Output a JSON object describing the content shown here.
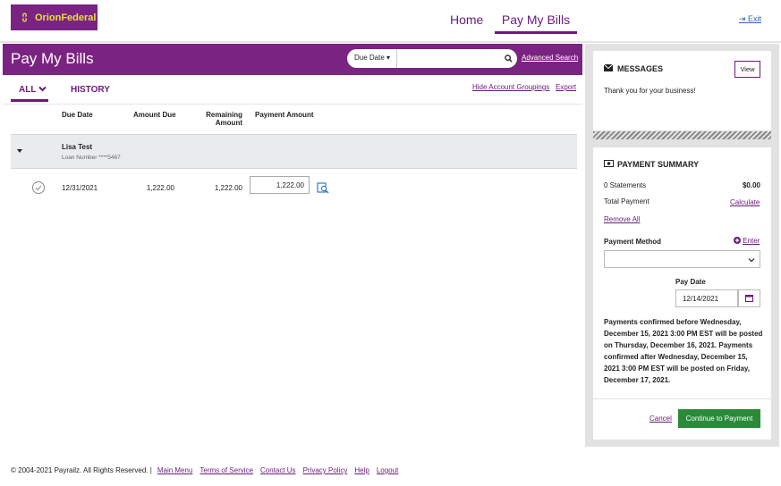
{
  "brand": {
    "name": "OrionFederal",
    "color": "#7b2382",
    "accent": "#e4e13a"
  },
  "nav": {
    "home": "Home",
    "pay_my_bills": "Pay My Bills",
    "exit": "Exit"
  },
  "page": {
    "title": "Pay My Bills",
    "search": {
      "filter": "Due Date",
      "placeholder": "",
      "advanced": "Advanced Search"
    },
    "tabs": {
      "all": "ALL",
      "history": "HISTORY"
    },
    "links": {
      "hide_groupings": "Hide Account Groupings",
      "export": "Export"
    }
  },
  "table": {
    "headers": {
      "due_date": "Due Date",
      "amount_due": "Amount Due",
      "remaining_1": "Remaining",
      "remaining_2": "Amount",
      "payment_amount": "Payment Amount"
    },
    "group": {
      "name": "Lisa Test",
      "loan": "Loan Number ****5467"
    },
    "rows": [
      {
        "due_date": "12/31/2021",
        "amount_due": "1,222.00",
        "remaining": "1,222.00",
        "payment": "1,222.00"
      }
    ]
  },
  "messages": {
    "title": "MESSAGES",
    "view": "View",
    "body": "Thank you for your business!"
  },
  "summary": {
    "title": "PAYMENT SUMMARY",
    "statements_label": "0 Statements",
    "statements_value": "$0.00",
    "total_label": "Total Payment",
    "calculate": "Calculate",
    "remove_all": "Remove All",
    "method_label": "Payment Method",
    "enter": "Enter",
    "pay_date_label": "Pay Date",
    "pay_date": "12/14/2021",
    "notice": "Payments confirmed before Wednesday, December 15, 2021 3:00 PM EST will be posted on Thursday, December 16, 2021. Payments confirmed after Wednesday, December 15, 2021 3:00 PM EST will be posted on Friday, December 17, 2021.",
    "cancel": "Cancel",
    "continue": "Continue to Payment"
  },
  "footer": {
    "copyright": "© 2004-2021 Payrailz. All Rights Reserved. |",
    "links": [
      "Main Menu",
      "Terms of Service",
      "Contact Us",
      "Privacy Policy",
      "Help",
      "Logout"
    ]
  }
}
